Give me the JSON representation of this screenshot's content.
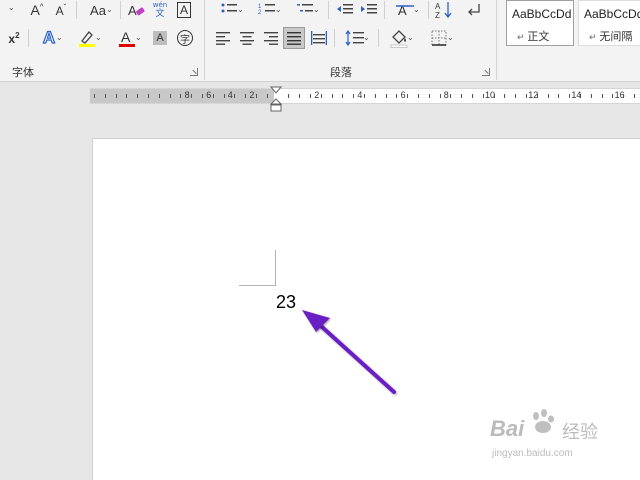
{
  "ribbon": {
    "font_group": {
      "label": "字体",
      "change_case_label": "Aa",
      "phonetic_top": "wén",
      "phonetic_bottom": "文",
      "char_border_label": "A",
      "highlight_color": "#ffff00",
      "font_color": "#e00000",
      "enclose_char_label": "字"
    },
    "paragraph_group": {
      "label": "段落"
    },
    "styles_group": {
      "styles": [
        {
          "sample": "AaBbCcDd",
          "name": "正文"
        },
        {
          "sample": "AaBbCcDd",
          "name": "无间隔"
        }
      ]
    }
  },
  "ruler": {
    "left_numbers": [
      "8",
      "6",
      "4",
      "2"
    ],
    "right_numbers": [
      "2",
      "4",
      "6",
      "8",
      "10",
      "12",
      "14",
      "16"
    ]
  },
  "document": {
    "text": "23"
  },
  "annotation": {
    "arrow_color": "#6a1fc4"
  },
  "watermark": {
    "brand": "Bai",
    "brand_suffix": "经验",
    "url": "jingyan.baidu.com"
  }
}
